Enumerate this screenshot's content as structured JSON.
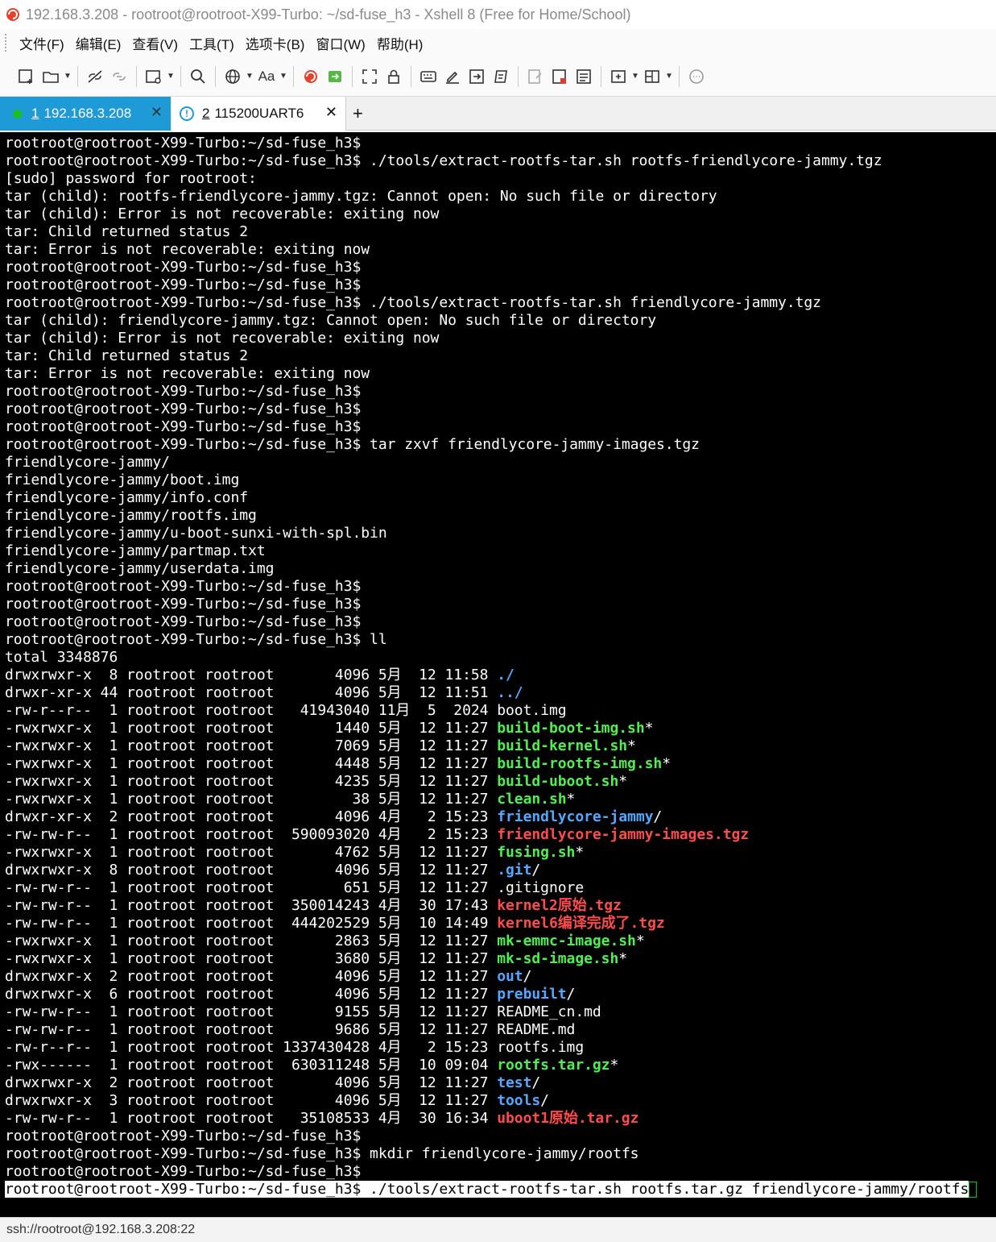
{
  "window": {
    "title": "192.168.3.208 - rootroot@rootroot-X99-Turbo: ~/sd-fuse_h3 - Xshell 8 (Free for Home/School)"
  },
  "menu": {
    "items": [
      "文件(F)",
      "编辑(E)",
      "查看(V)",
      "工具(T)",
      "选项卡(B)",
      "窗口(W)",
      "帮助(H)"
    ]
  },
  "toolbar": {
    "font_label": "Aa"
  },
  "tabs": [
    {
      "num": "1",
      "label": "192.168.3.208",
      "close": "✕"
    },
    {
      "num": "2",
      "label": "115200UART6",
      "close": "✕"
    }
  ],
  "new_tab": "+",
  "terminal": {
    "lines": [
      [
        {
          "t": "rootroot@rootroot-X99-Turbo:~/sd-fuse_h3$"
        }
      ],
      [
        {
          "t": "rootroot@rootroot-X99-Turbo:~/sd-fuse_h3$ ./tools/extract-rootfs-tar.sh rootfs-friendlycore-jammy.tgz"
        }
      ],
      [
        {
          "t": "[sudo] password for rootroot:"
        }
      ],
      [
        {
          "t": "tar (child): rootfs-friendlycore-jammy.tgz: Cannot open: No such file or directory"
        }
      ],
      [
        {
          "t": "tar (child): Error is not recoverable: exiting now"
        }
      ],
      [
        {
          "t": "tar: Child returned status 2"
        }
      ],
      [
        {
          "t": "tar: Error is not recoverable: exiting now"
        }
      ],
      [
        {
          "t": "rootroot@rootroot-X99-Turbo:~/sd-fuse_h3$"
        }
      ],
      [
        {
          "t": "rootroot@rootroot-X99-Turbo:~/sd-fuse_h3$"
        }
      ],
      [
        {
          "t": "rootroot@rootroot-X99-Turbo:~/sd-fuse_h3$ ./tools/extract-rootfs-tar.sh friendlycore-jammy.tgz"
        }
      ],
      [
        {
          "t": "tar (child): friendlycore-jammy.tgz: Cannot open: No such file or directory"
        }
      ],
      [
        {
          "t": "tar (child): Error is not recoverable: exiting now"
        }
      ],
      [
        {
          "t": "tar: Child returned status 2"
        }
      ],
      [
        {
          "t": "tar: Error is not recoverable: exiting now"
        }
      ],
      [
        {
          "t": "rootroot@rootroot-X99-Turbo:~/sd-fuse_h3$"
        }
      ],
      [
        {
          "t": "rootroot@rootroot-X99-Turbo:~/sd-fuse_h3$"
        }
      ],
      [
        {
          "t": "rootroot@rootroot-X99-Turbo:~/sd-fuse_h3$"
        }
      ],
      [
        {
          "t": "rootroot@rootroot-X99-Turbo:~/sd-fuse_h3$ tar zxvf friendlycore-jammy-images.tgz"
        }
      ],
      [
        {
          "t": "friendlycore-jammy/"
        }
      ],
      [
        {
          "t": "friendlycore-jammy/boot.img"
        }
      ],
      [
        {
          "t": "friendlycore-jammy/info.conf"
        }
      ],
      [
        {
          "t": "friendlycore-jammy/rootfs.img"
        }
      ],
      [
        {
          "t": "friendlycore-jammy/u-boot-sunxi-with-spl.bin"
        }
      ],
      [
        {
          "t": "friendlycore-jammy/partmap.txt"
        }
      ],
      [
        {
          "t": "friendlycore-jammy/userdata.img"
        }
      ],
      [
        {
          "t": "rootroot@rootroot-X99-Turbo:~/sd-fuse_h3$"
        }
      ],
      [
        {
          "t": "rootroot@rootroot-X99-Turbo:~/sd-fuse_h3$"
        }
      ],
      [
        {
          "t": "rootroot@rootroot-X99-Turbo:~/sd-fuse_h3$"
        }
      ],
      [
        {
          "t": "rootroot@rootroot-X99-Turbo:~/sd-fuse_h3$ ll"
        }
      ],
      [
        {
          "t": "total 3348876"
        }
      ],
      [
        {
          "t": "drwxrwxr-x  8 rootroot rootroot       4096 5月  12 11:58 "
        },
        {
          "t": "./",
          "c": "b"
        }
      ],
      [
        {
          "t": "drwxr-xr-x 44 rootroot rootroot       4096 5月  12 11:51 "
        },
        {
          "t": "../",
          "c": "b"
        }
      ],
      [
        {
          "t": "-rw-r--r--  1 rootroot rootroot   41943040 11月  5  2024 boot.img"
        }
      ],
      [
        {
          "t": "-rwxrwxr-x  1 rootroot rootroot       1440 5月  12 11:27 "
        },
        {
          "t": "build-boot-img.sh",
          "c": "g"
        },
        {
          "t": "*"
        }
      ],
      [
        {
          "t": "-rwxrwxr-x  1 rootroot rootroot       7069 5月  12 11:27 "
        },
        {
          "t": "build-kernel.sh",
          "c": "g"
        },
        {
          "t": "*"
        }
      ],
      [
        {
          "t": "-rwxrwxr-x  1 rootroot rootroot       4448 5月  12 11:27 "
        },
        {
          "t": "build-rootfs-img.sh",
          "c": "g"
        },
        {
          "t": "*"
        }
      ],
      [
        {
          "t": "-rwxrwxr-x  1 rootroot rootroot       4235 5月  12 11:27 "
        },
        {
          "t": "build-uboot.sh",
          "c": "g"
        },
        {
          "t": "*"
        }
      ],
      [
        {
          "t": "-rwxrwxr-x  1 rootroot rootroot         38 5月  12 11:27 "
        },
        {
          "t": "clean.sh",
          "c": "g"
        },
        {
          "t": "*"
        }
      ],
      [
        {
          "t": "drwxr-xr-x  2 rootroot rootroot       4096 4月   2 15:23 "
        },
        {
          "t": "friendlycore-jammy",
          "c": "b"
        },
        {
          "t": "/"
        }
      ],
      [
        {
          "t": "-rw-rw-r--  1 rootroot rootroot  590093020 4月   2 15:23 "
        },
        {
          "t": "friendlycore-jammy-images.tgz",
          "c": "r"
        }
      ],
      [
        {
          "t": "-rwxrwxr-x  1 rootroot rootroot       4762 5月  12 11:27 "
        },
        {
          "t": "fusing.sh",
          "c": "g"
        },
        {
          "t": "*"
        }
      ],
      [
        {
          "t": "drwxrwxr-x  8 rootroot rootroot       4096 5月  12 11:27 "
        },
        {
          "t": ".git",
          "c": "b"
        },
        {
          "t": "/"
        }
      ],
      [
        {
          "t": "-rw-rw-r--  1 rootroot rootroot        651 5月  12 11:27 .gitignore"
        }
      ],
      [
        {
          "t": "-rw-rw-r--  1 rootroot rootroot  350014243 4月  30 17:43 "
        },
        {
          "t": "kernel2原始.tgz",
          "c": "r"
        }
      ],
      [
        {
          "t": "-rw-rw-r--  1 rootroot rootroot  444202529 5月  10 14:49 "
        },
        {
          "t": "kernel6编译完成了.tgz",
          "c": "r"
        }
      ],
      [
        {
          "t": "-rwxrwxr-x  1 rootroot rootroot       2863 5月  12 11:27 "
        },
        {
          "t": "mk-emmc-image.sh",
          "c": "g"
        },
        {
          "t": "*"
        }
      ],
      [
        {
          "t": "-rwxrwxr-x  1 rootroot rootroot       3680 5月  12 11:27 "
        },
        {
          "t": "mk-sd-image.sh",
          "c": "g"
        },
        {
          "t": "*"
        }
      ],
      [
        {
          "t": "drwxrwxr-x  2 rootroot rootroot       4096 5月  12 11:27 "
        },
        {
          "t": "out",
          "c": "b"
        },
        {
          "t": "/"
        }
      ],
      [
        {
          "t": "drwxrwxr-x  6 rootroot rootroot       4096 5月  12 11:27 "
        },
        {
          "t": "prebuilt",
          "c": "b"
        },
        {
          "t": "/"
        }
      ],
      [
        {
          "t": "-rw-rw-r--  1 rootroot rootroot       9155 5月  12 11:27 README_cn.md"
        }
      ],
      [
        {
          "t": "-rw-rw-r--  1 rootroot rootroot       9686 5月  12 11:27 README.md"
        }
      ],
      [
        {
          "t": "-rw-r--r--  1 rootroot rootroot 1337430428 4月   2 15:23 rootfs.img"
        }
      ],
      [
        {
          "t": "-rwx------  1 rootroot rootroot  630311248 5月  10 09:04 "
        },
        {
          "t": "rootfs.tar.gz",
          "c": "g"
        },
        {
          "t": "*"
        }
      ],
      [
        {
          "t": "drwxrwxr-x  2 rootroot rootroot       4096 5月  12 11:27 "
        },
        {
          "t": "test",
          "c": "b"
        },
        {
          "t": "/"
        }
      ],
      [
        {
          "t": "drwxrwxr-x  3 rootroot rootroot       4096 5月  12 11:27 "
        },
        {
          "t": "tools",
          "c": "b"
        },
        {
          "t": "/"
        }
      ],
      [
        {
          "t": "-rw-rw-r--  1 rootroot rootroot   35108533 4月  30 16:34 "
        },
        {
          "t": "uboot1原始.tar.gz",
          "c": "r"
        }
      ],
      [
        {
          "t": "rootroot@rootroot-X99-Turbo:~/sd-fuse_h3$"
        }
      ],
      [
        {
          "t": "rootroot@rootroot-X99-Turbo:~/sd-fuse_h3$ mkdir friendlycore-jammy/rootfs"
        }
      ],
      [
        {
          "t": "rootroot@rootroot-X99-Turbo:~/sd-fuse_h3$"
        }
      ],
      [
        {
          "t": "rootroot@rootroot-X99-Turbo:~/sd-fuse_h3$ ./tools/extract-rootfs-tar.sh rootfs.tar.gz friendlycore-jammy/rootfs",
          "c": "hl"
        }
      ]
    ]
  },
  "status": {
    "text": "ssh://rootroot@192.168.3.208:22"
  }
}
